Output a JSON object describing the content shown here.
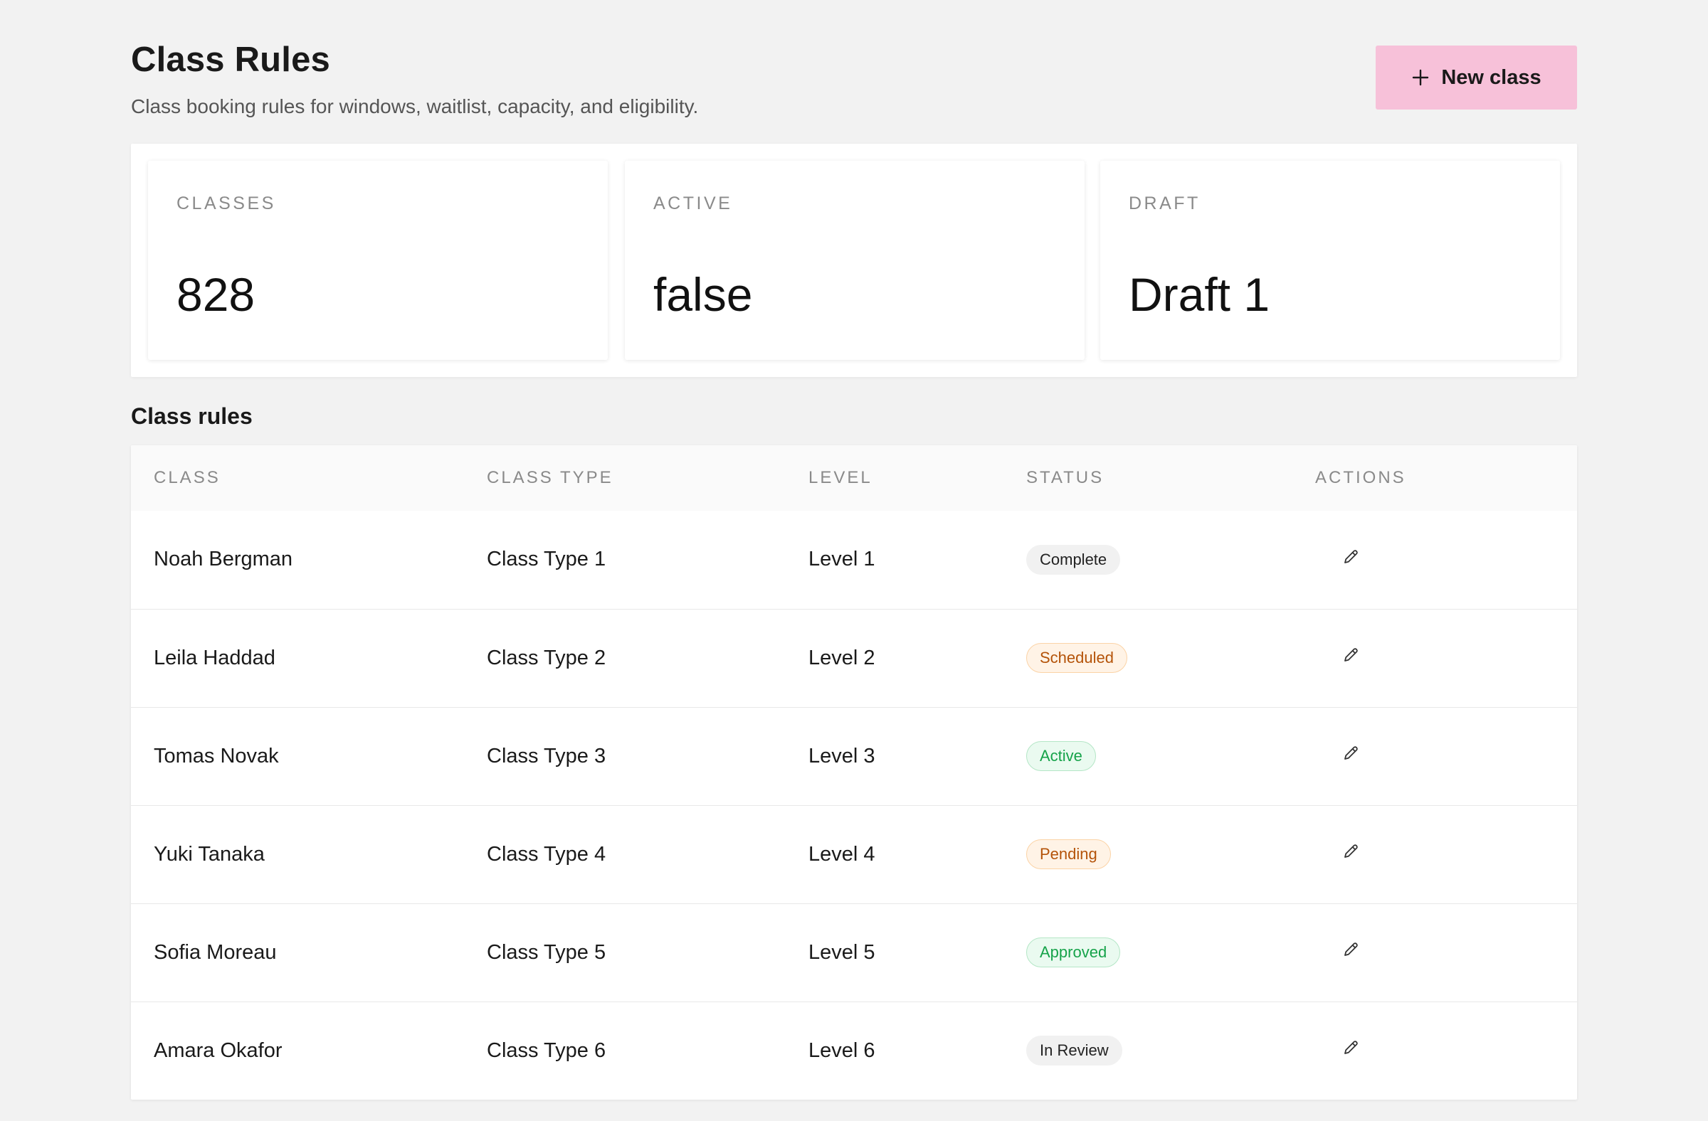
{
  "header": {
    "title": "Class Rules",
    "subtitle": "Class booking rules for windows, waitlist, capacity, and eligibility.",
    "new_button_label": "New class"
  },
  "stats": [
    {
      "label": "CLASSES",
      "value": "828"
    },
    {
      "label": "ACTIVE",
      "value": "false"
    },
    {
      "label": "DRAFT",
      "value": "Draft 1"
    }
  ],
  "table": {
    "section_title": "Class rules",
    "columns": [
      "CLASS",
      "CLASS TYPE",
      "LEVEL",
      "STATUS",
      "ACTIONS"
    ],
    "rows": [
      {
        "class": "Noah Bergman",
        "class_type": "Class Type 1",
        "level": "Level 1",
        "status": "Complete",
        "status_tone": "neutral"
      },
      {
        "class": "Leila Haddad",
        "class_type": "Class Type 2",
        "level": "Level 2",
        "status": "Scheduled",
        "status_tone": "warning"
      },
      {
        "class": "Tomas Novak",
        "class_type": "Class Type 3",
        "level": "Level 3",
        "status": "Active",
        "status_tone": "success"
      },
      {
        "class": "Yuki Tanaka",
        "class_type": "Class Type 4",
        "level": "Level 4",
        "status": "Pending",
        "status_tone": "warning"
      },
      {
        "class": "Sofia Moreau",
        "class_type": "Class Type 5",
        "level": "Level 5",
        "status": "Approved",
        "status_tone": "success"
      },
      {
        "class": "Amara Okafor",
        "class_type": "Class Type 6",
        "level": "Level 6",
        "status": "In Review",
        "status_tone": "neutral"
      }
    ]
  },
  "icons": {
    "add": "plus-icon",
    "edit": "pencil-icon"
  },
  "colors": {
    "background": "#f2f2f2",
    "primary_button": "#f7c1d9",
    "warning_text": "#b45309",
    "success_text": "#16a34a"
  }
}
